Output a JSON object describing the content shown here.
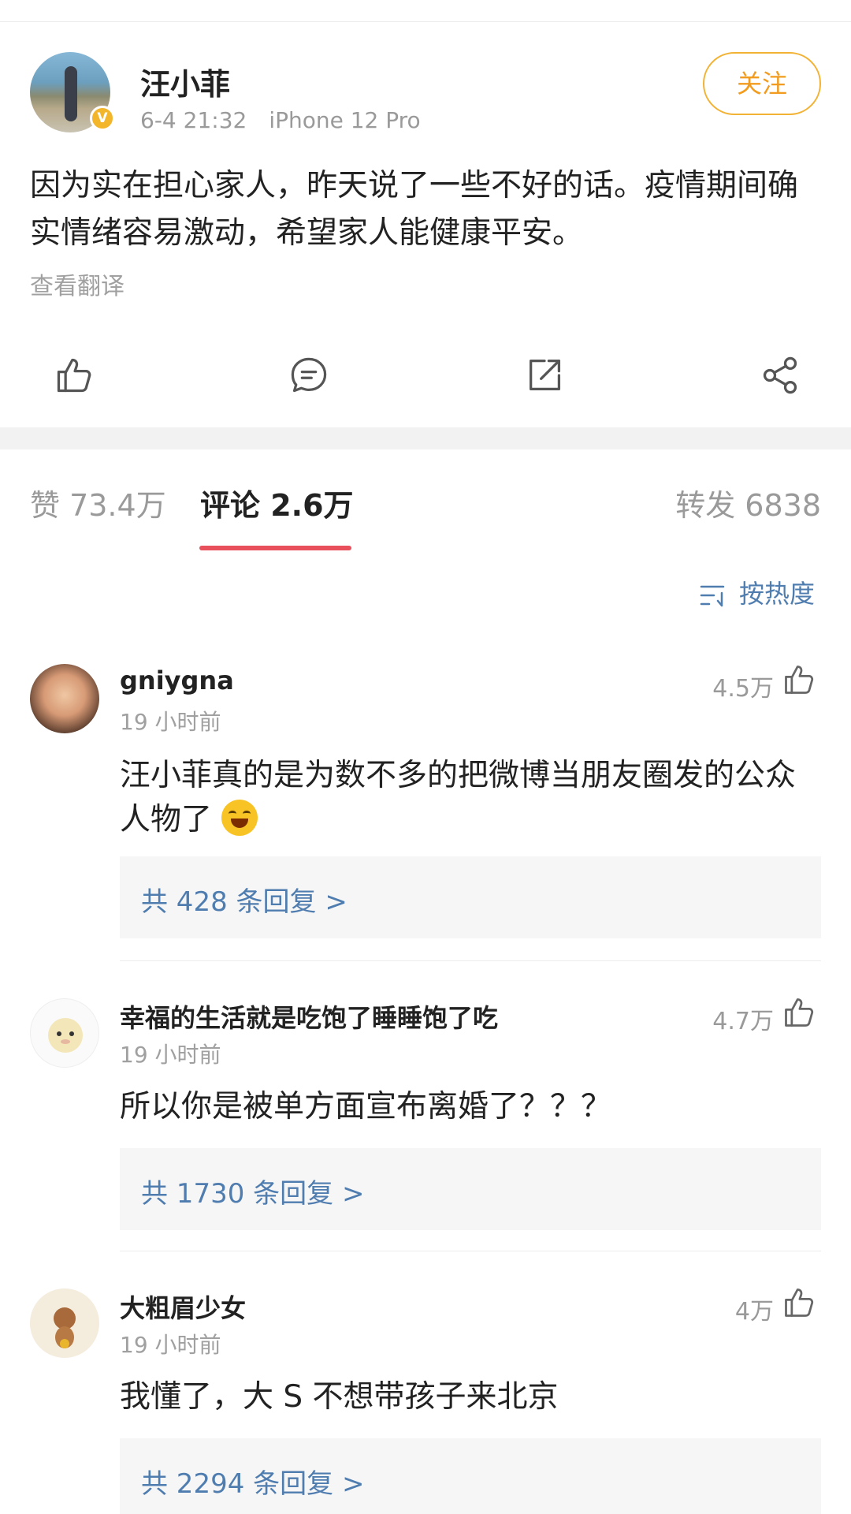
{
  "post": {
    "author_name": "汪小菲",
    "verified_badge": "V",
    "time": "6-4 21:32",
    "device": "iPhone 12 Pro",
    "follow_label": "关注",
    "text": "因为实在担心家人，昨天说了一些不好的话。疫情期间确实情绪容易激动，希望家人能健康平安。",
    "translate_label": "查看翻译",
    "actions": [
      "like-icon",
      "comment-icon",
      "repost-icon",
      "share-icon"
    ]
  },
  "tabs": [
    {
      "label": "赞 73.4万",
      "active": false
    },
    {
      "label": "评论 2.6万",
      "active": true
    },
    {
      "label": "转发 6838",
      "active": false
    }
  ],
  "sort": {
    "label": "按热度"
  },
  "comments": [
    {
      "username": "gniygna",
      "time": "19 小时前",
      "likes": "4.5万",
      "text": "汪小菲真的是为数不多的把微博当朋友圈发的公众人物了",
      "has_emoji": true,
      "replies": "共 428 条回复 >"
    },
    {
      "username": "幸福的生活就是吃饱了睡睡饱了吃",
      "time": "19 小时前",
      "likes": "4.7万",
      "text": "所以你是被单方面宣布离婚了？？？",
      "has_emoji": false,
      "replies": "共 1730 条回复 >"
    },
    {
      "username": "大粗眉少女",
      "time": "19 小时前",
      "likes": "4万",
      "text": "我懂了，大 S 不想带孩子来北京",
      "has_emoji": false,
      "replies": "共 2294 条回复 >"
    }
  ],
  "colors": {
    "accent_follow": "#f29c1f",
    "tab_underline": "#e8505b",
    "link_blue": "#507daf",
    "separator": "#f2f2f2"
  }
}
